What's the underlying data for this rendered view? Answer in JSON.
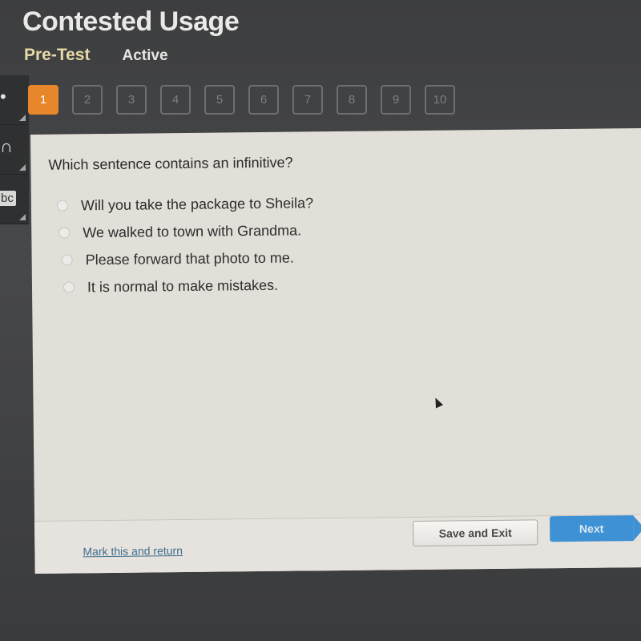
{
  "header": {
    "title": "Contested Usage",
    "subtitle": "Pre-Test",
    "status": "Active"
  },
  "side_tools": [
    {
      "icon": "pointer-icon",
      "glyph": "•"
    },
    {
      "icon": "audio-icon",
      "glyph": "∩"
    },
    {
      "icon": "dictionary-icon",
      "glyph": "bc"
    }
  ],
  "question_nav": {
    "current": 1,
    "items": [
      "1",
      "2",
      "3",
      "4",
      "5",
      "6",
      "7",
      "8",
      "9",
      "10"
    ]
  },
  "question": {
    "prompt": "Which sentence contains an infinitive?",
    "options": [
      "Will you take the package to Sheila?",
      "We walked to town with Grandma.",
      "Please forward that photo to me.",
      "It is normal to make mistakes."
    ],
    "selected": null
  },
  "footer": {
    "mark_link": "Mark this and return",
    "save_label": "Save and Exit",
    "next_label": "Next"
  },
  "colors": {
    "current_question": "#e8862b",
    "next_button": "#3e91d4",
    "pretest_label": "#e6d9a6",
    "link": "#3f6e8e"
  }
}
